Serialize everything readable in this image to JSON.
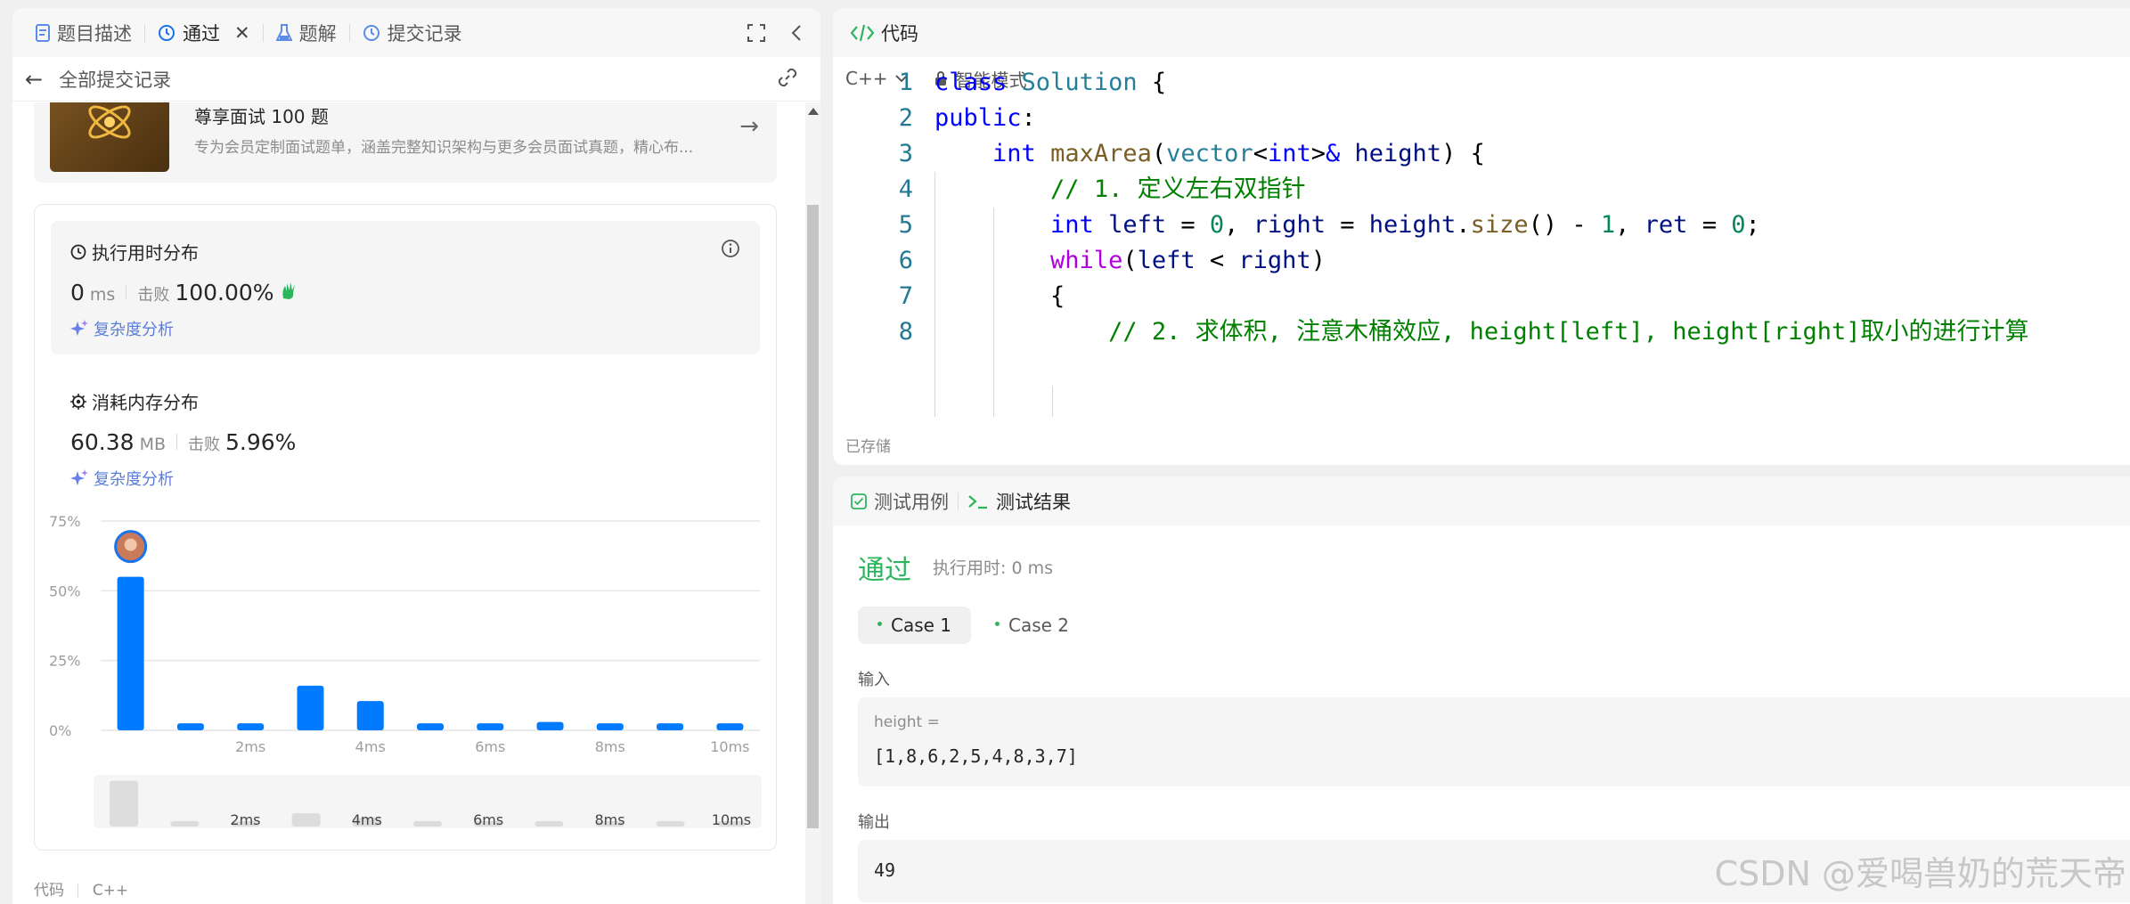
{
  "left_tabs": [
    {
      "label": "题目描述",
      "icon": "doc-icon"
    },
    {
      "label": "通过",
      "icon": "history-icon"
    },
    {
      "label": "题解",
      "icon": "flask-icon"
    },
    {
      "label": "提交记录",
      "icon": "history-icon"
    }
  ],
  "back_label": "全部提交记录",
  "promo": {
    "title": "尊享面试 100 题",
    "desc": "专为会员定制面试题单，涵盖完整知识架构与更多会员面试真题，精心布..."
  },
  "runtime": {
    "title": "执行用时分布",
    "value": "0",
    "unit": "ms",
    "beat_label": "击败",
    "percent": "100.00%",
    "complexity_label": "复杂度分析"
  },
  "memory": {
    "title": "消耗内存分布",
    "value": "60.38",
    "unit": "MB",
    "beat_label": "击败",
    "percent": "5.96%",
    "complexity_label": "复杂度分析"
  },
  "chart_data": {
    "type": "bar",
    "yticks": [
      "75%",
      "50%",
      "25%",
      "0%"
    ],
    "yvalues": [
      75,
      50,
      25,
      0
    ],
    "ylim": [
      0,
      75
    ],
    "xticks": [
      "2ms",
      "4ms",
      "6ms",
      "8ms",
      "10ms"
    ],
    "x": [
      0,
      1,
      2,
      3,
      4,
      5,
      6,
      7,
      8,
      9,
      10
    ],
    "values": [
      55,
      2.5,
      2.5,
      16,
      10.5,
      2.5,
      2.5,
      3,
      2.5,
      2.5,
      2.5
    ],
    "highlight_index": 0,
    "color": "#007aff"
  },
  "mini_strip": {
    "labels": [
      "2ms",
      "4ms",
      "6ms",
      "8ms",
      "10ms"
    ]
  },
  "footer": {
    "code_label": "代码",
    "lang": "C++"
  },
  "code_panel": {
    "title": "代码",
    "lang": "C++",
    "mode": "智能模式",
    "saved": "已存储"
  },
  "code": [
    {
      "n": "1",
      "indent": 0
    },
    {
      "n": "2",
      "indent": 0
    },
    {
      "n": "3",
      "indent": 1
    },
    {
      "n": "4",
      "indent": 2
    },
    {
      "n": "5",
      "indent": 2
    },
    {
      "n": "6",
      "indent": 2
    },
    {
      "n": "7",
      "indent": 2
    },
    {
      "n": "8",
      "indent": 3
    }
  ],
  "result": {
    "tab_testcase": "测试用例",
    "tab_result": "测试结果",
    "status": "通过",
    "runtime": "执行用时: 0 ms",
    "cases": [
      "Case 1",
      "Case 2"
    ],
    "input_label": "输入",
    "var_name": "height =",
    "input_value": "[1,8,6,2,5,4,8,3,7]",
    "output_label": "输出",
    "output_value": "49"
  },
  "watermark": "CSDN @爱喝兽奶的荒天帝"
}
